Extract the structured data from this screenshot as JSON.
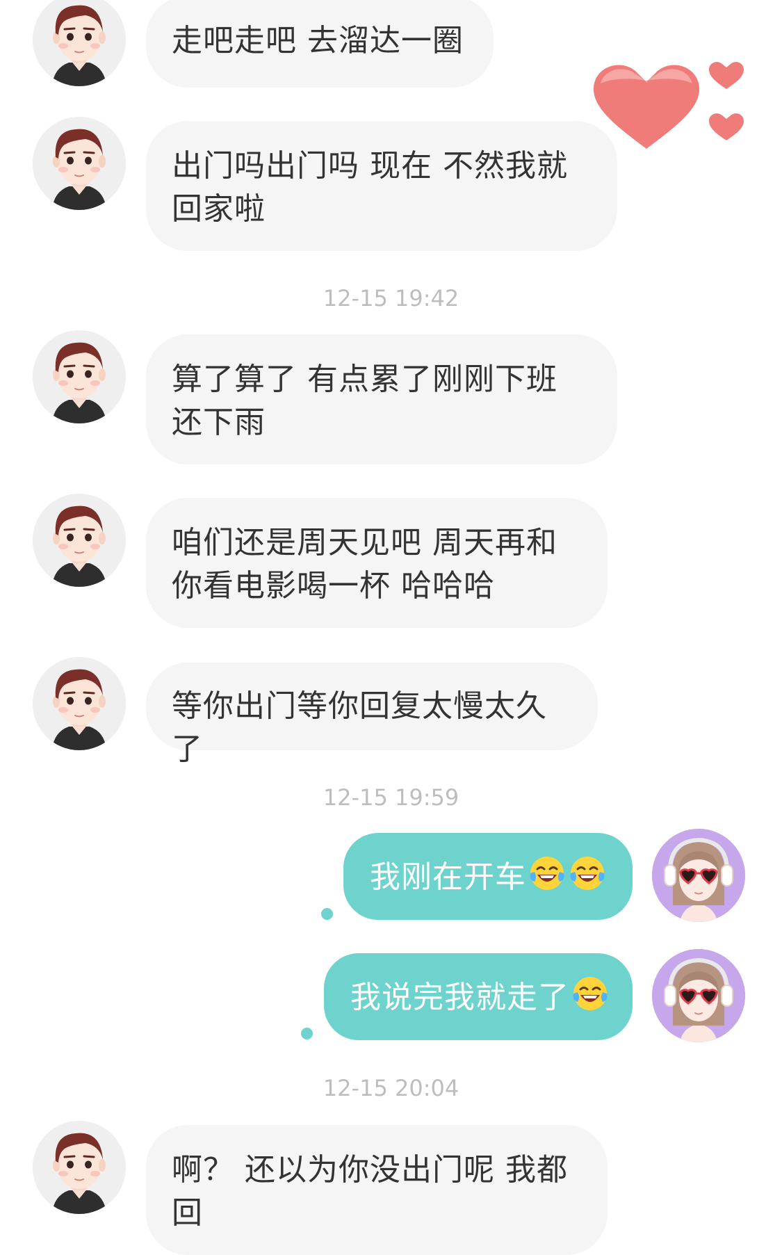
{
  "messages": [
    {
      "text": "走吧走吧 去溜达一圈"
    },
    {
      "text": "出门吗出门吗 现在 不然我就回家啦"
    },
    {
      "text": "算了算了 有点累了刚刚下班 还下雨"
    },
    {
      "text": "咱们还是周天见吧 周天再和你看电影喝一杯 哈哈哈"
    },
    {
      "text": "等你出门等你回复太慢太久了"
    },
    {
      "text": "我刚在开车",
      "emoji": [
        "laughing-tears-emoji",
        "laughing-tears-emoji"
      ]
    },
    {
      "text": "我说完我就走了",
      "emoji": [
        "laughing-tears-emoji"
      ]
    },
    {
      "text": "啊？ 还以为你没出门呢 我都回"
    }
  ],
  "timestamps": [
    "12-15 19:42",
    "12-15 19:59",
    "12-15 20:04"
  ],
  "colors": {
    "incoming_bubble": "#f5f5f5",
    "outgoing_bubble": "#6dd3cc",
    "timestamp": "#bdbdbd",
    "heart": "#f07c79"
  },
  "icons": [
    "male-avatar",
    "female-avatar",
    "heart-decoration-icon",
    "laughing-tears-emoji"
  ]
}
